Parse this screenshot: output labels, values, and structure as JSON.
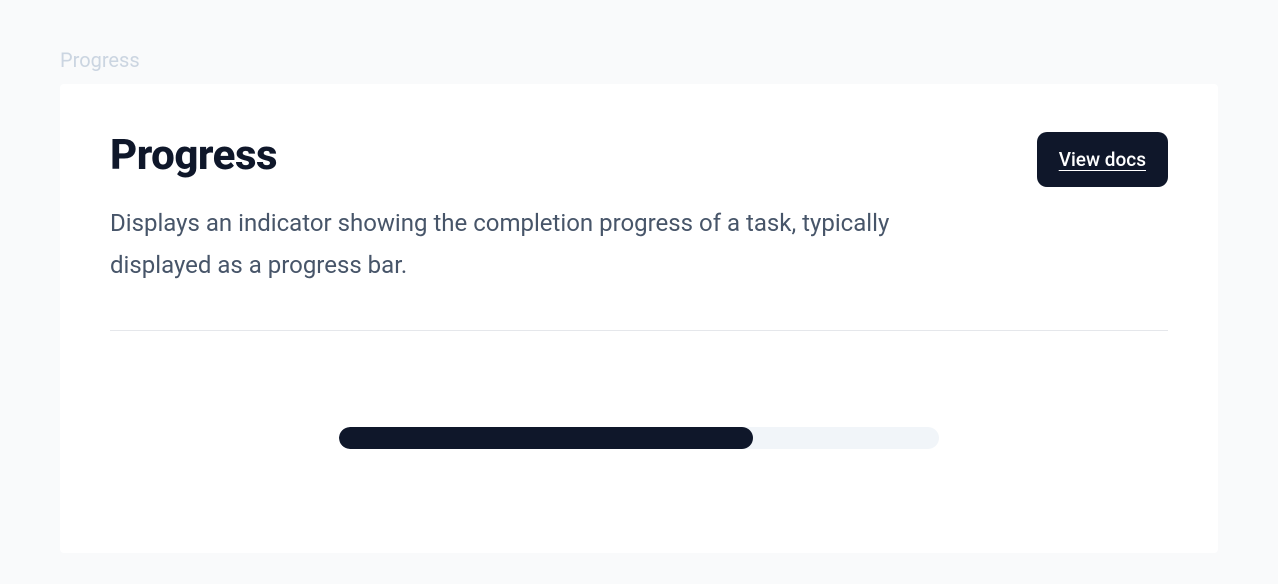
{
  "breadcrumb": "Progress",
  "title": "Progress",
  "description": "Displays an indicator showing the completion progress of a task, typically displayed as a progress bar.",
  "button": {
    "label": "View docs"
  },
  "progress": {
    "value": 69
  },
  "colors": {
    "card_bg": "#ffffff",
    "page_bg": "#f9fafb",
    "title": "#0f172a",
    "description": "#475569",
    "breadcrumb": "#cbd5e1",
    "button_bg": "#0f172a",
    "button_text": "#ffffff",
    "progress_track": "#f1f5f9",
    "progress_fill": "#0f172a",
    "divider": "#e5e7eb"
  }
}
